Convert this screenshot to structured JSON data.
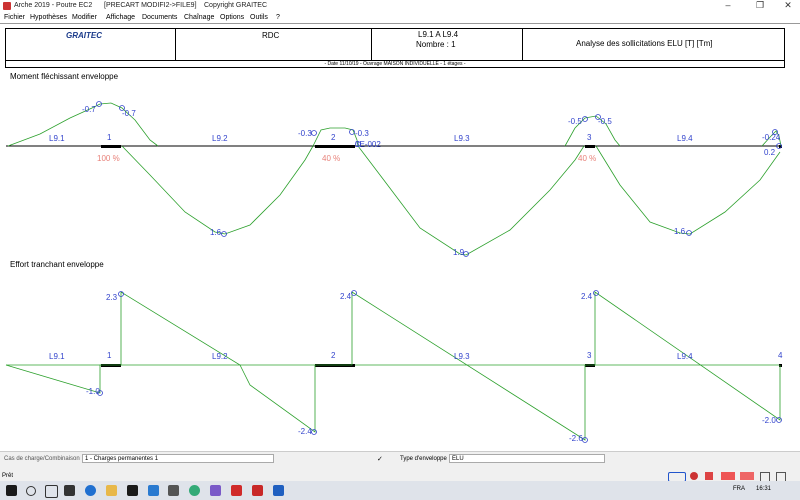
{
  "window": {
    "title": "Arche 2019 - Poutre EC2",
    "file": "[PRECART MODIFI2->FILE9]",
    "copyright": "Copyright GRAITEC"
  },
  "menu": [
    "Fichier",
    "Hypothèses",
    "Modifier",
    "Affichage",
    "Documents",
    "Chaînage",
    "Options",
    "Outils",
    "?"
  ],
  "header": {
    "logo": "GRAITEC",
    "level": "RDC",
    "beam_range": "L9.1 A L9.4",
    "count": "Nombre : 1",
    "analysis": "Analyse des sollicitations ELU [T] [Tm]",
    "subline": "- Date 11/10/19 - Ouvrage MAISON INDIVIDUELLE - 1 étages -"
  },
  "moment": {
    "title": "Moment fléchissant enveloppe",
    "spans": [
      "L9.1",
      "L9.2",
      "L9.3",
      "L9.4"
    ],
    "supports": [
      "1",
      "2",
      "3"
    ],
    "percents": [
      "100 %",
      "40 %",
      "40 %"
    ],
    "labels": {
      "s1_left": "-0.7",
      "s1_right": "-0.7",
      "s2_left": "-0.3",
      "s2_right": "-0.3",
      "s2_small": "3E-002",
      "s3_left": "-0.5",
      "s3_right": "-0.5",
      "end_top": "-0.24",
      "end_bottom": "0.2",
      "span2_max": "1.6",
      "span3_max": "1.9",
      "span4_max": "1.6"
    }
  },
  "shear": {
    "title": "Effort tranchant enveloppe",
    "spans": [
      "L9.1",
      "L9.2",
      "L9.3",
      "L9.4"
    ],
    "supports": [
      "1",
      "2",
      "3",
      "4"
    ],
    "labels": {
      "s1_bottom": "-1.0",
      "s1_top": "2.3",
      "s2_bottom": "-2.4",
      "s2_top": "2.4",
      "s3_bottom": "-2.6",
      "s3_top": "2.4",
      "s4_bottom": "-2.0"
    }
  },
  "status": {
    "combo_label": "Cas de charge/Combinaison",
    "combo_value": "1 - Charges permanentes 1",
    "check": "✓",
    "env_label": "Type d'enveloppe",
    "env_value": "ELU",
    "ready": "Prêt"
  },
  "tray": {
    "lang": "FRA",
    "time": "16:31"
  },
  "colors": {
    "curve": "#2ca02c",
    "label": "#3344cc",
    "percent": "#e8827a",
    "baseline": "#000000"
  }
}
